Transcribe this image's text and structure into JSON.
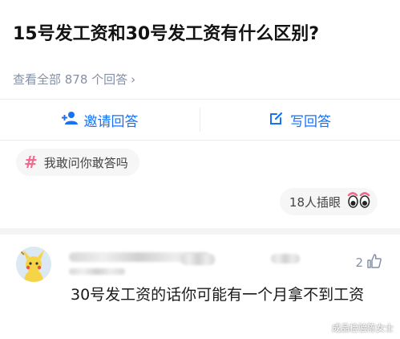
{
  "question": {
    "title": "15号发工资和30号发工资有什么区别?",
    "meta": "查看全部 878 个回答"
  },
  "actions": {
    "invite_label": "邀请回答",
    "write_label": "写回答"
  },
  "tag": {
    "label": "我敢问你敢答吗"
  },
  "watchers": {
    "label": "18人插眼"
  },
  "answer": {
    "like_count": "2",
    "text": "30号发工资的话你可能有一个月拿不到工资"
  },
  "watermark": "成品检验陈女士",
  "colors": {
    "accent": "#1772f6",
    "meta": "#8590a6",
    "tag_hash": "#f06a8f"
  },
  "icons": [
    "add-user-icon",
    "edit-icon",
    "hash-icon",
    "eyes-icon",
    "thumbs-up-icon",
    "chevron-right-icon"
  ]
}
